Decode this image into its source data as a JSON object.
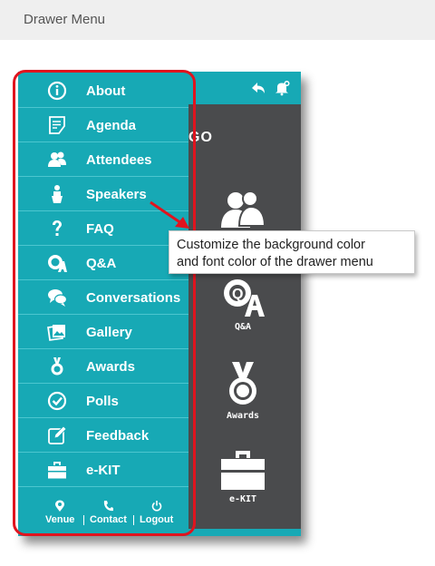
{
  "window": {
    "title": "Drawer Menu"
  },
  "phone": {
    "header_icons": [
      "back-arrow-icon",
      "notification-bell-icon"
    ],
    "background": {
      "title_fragment": "GO",
      "tiles": [
        {
          "label": "",
          "icon": "attendees-icon"
        },
        {
          "label": "Q&A",
          "icon": "qa-icon"
        },
        {
          "label": "Awards",
          "icon": "award-medal-icon"
        },
        {
          "label": "e-KIT",
          "icon": "briefcase-icon"
        }
      ]
    }
  },
  "drawer": {
    "colors": {
      "background": "#17a9b5",
      "divider": "#4cc6cf",
      "text": "#ffffff"
    },
    "items": [
      {
        "label": "About",
        "icon": "info-icon"
      },
      {
        "label": "Agenda",
        "icon": "agenda-icon"
      },
      {
        "label": "Attendees",
        "icon": "attendees-icon"
      },
      {
        "label": "Speakers",
        "icon": "speaker-icon"
      },
      {
        "label": "FAQ",
        "icon": "question-icon"
      },
      {
        "label": "Q&A",
        "icon": "qa-icon"
      },
      {
        "label": "Conversations",
        "icon": "chat-icon"
      },
      {
        "label": "Gallery",
        "icon": "gallery-icon"
      },
      {
        "label": "Awards",
        "icon": "award-medal-icon"
      },
      {
        "label": "Polls",
        "icon": "check-circle-icon"
      },
      {
        "label": "Feedback",
        "icon": "edit-icon"
      },
      {
        "label": "e-KIT",
        "icon": "briefcase-icon"
      }
    ],
    "footer": [
      {
        "label": "Venue",
        "icon": "location-pin-icon"
      },
      {
        "label": "Contact",
        "icon": "phone-icon"
      },
      {
        "label": "Logout",
        "icon": "power-icon"
      }
    ]
  },
  "annotation": {
    "text_line1": "Customize the background color",
    "text_line2": "and font color of the drawer menu",
    "highlight_color": "#e0141e"
  }
}
